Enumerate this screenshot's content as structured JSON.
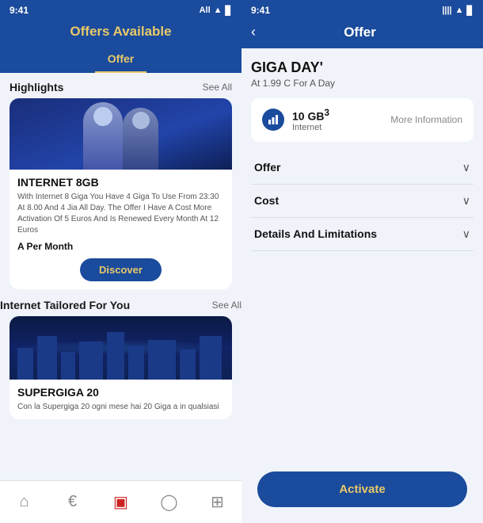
{
  "left": {
    "statusBar": {
      "time": "9:41",
      "carrier": "All",
      "battery": "█"
    },
    "title": "Offers Available",
    "tabs": [
      {
        "label": "Offer",
        "active": true
      }
    ],
    "sections": [
      {
        "id": "highlights",
        "title": "Highlights",
        "seeAllLabel": "See All"
      },
      {
        "id": "tailored",
        "title": "Internet Tailored For You",
        "seeAllLabel": "See All"
      }
    ],
    "cards": [
      {
        "id": "internet8gb",
        "title": "INTERNET 8GB",
        "description": "With Internet 8 Giga You Have 4 Giga To Use From 23:30 At 8.00 And 4 Jia All Day. The Offer I Have A Cost More Activation Of 5 Euros And Is Renewed Every Month At 12 Euros",
        "price": "A Per Month",
        "discoverLabel": "Discover"
      },
      {
        "id": "supergiga20",
        "title": "SUPERGIGA 20",
        "description": "Con la Supergiga 20 ogni mese hai 20 Giga a in qualsiasi"
      }
    ],
    "bottomNav": [
      {
        "id": "home",
        "icon": "⌂",
        "label": "Home",
        "active": false
      },
      {
        "id": "offers",
        "icon": "€",
        "label": "Offers",
        "active": false
      },
      {
        "id": "sim",
        "icon": "▣",
        "label": "SIM",
        "active": true
      },
      {
        "id": "chat",
        "icon": "◯",
        "label": "Chat",
        "active": false
      },
      {
        "id": "menu",
        "icon": "⊞",
        "label": "Menu",
        "active": false
      }
    ]
  },
  "right": {
    "statusBar": {
      "time": "9:41",
      "signal": "||||",
      "wifi": "▲",
      "battery": "█"
    },
    "backLabel": "‹",
    "title": "Offer",
    "offerTitle": "GIGA DAY'",
    "offerSubtitle": "At 1.99 C For A Day",
    "dataCard": {
      "amount": "10 GB",
      "superscript": "3",
      "label": "Internet",
      "moreInfoLabel": "More Information"
    },
    "accordion": [
      {
        "label": "Offer",
        "open": false
      },
      {
        "label": "Cost",
        "open": false
      },
      {
        "label": "Details And Limitations",
        "open": false
      }
    ],
    "activateLabel": "Activate"
  }
}
